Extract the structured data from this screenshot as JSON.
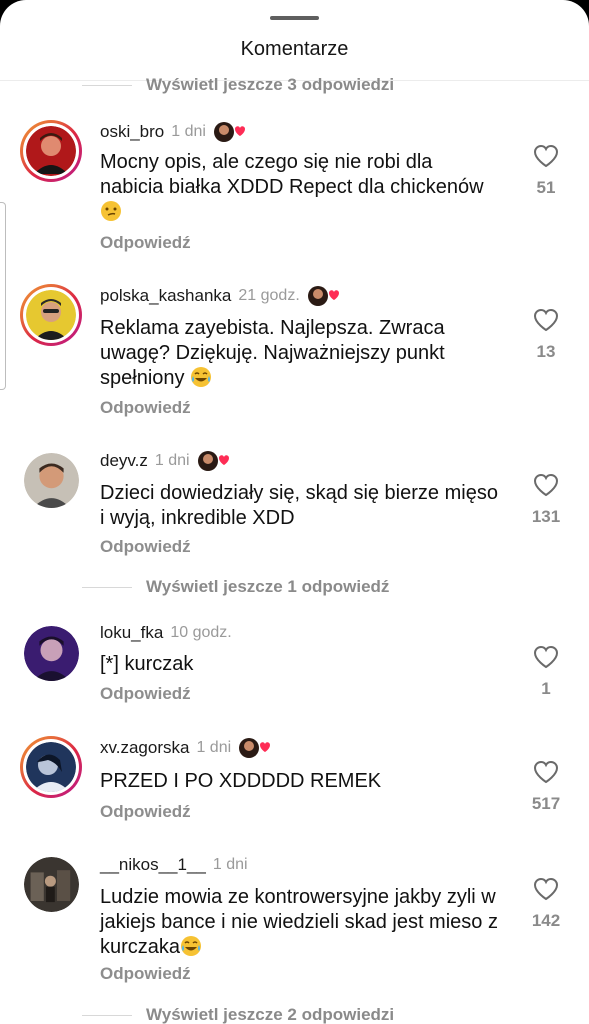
{
  "header": {
    "title": "Komentarze"
  },
  "more_replies": {
    "top": "Wyświetl jeszcze 3 odpowiedzi",
    "middle": "Wyświetl jeszcze 1 odpowiedź",
    "bottom": "Wyświetl jeszcze 2 odpowiedzi"
  },
  "reply_label": "Odpowiedź",
  "comments": [
    {
      "username": "oski_bro",
      "time": "1 dni",
      "text": "Mocny opis, ale czego się nie robi dla nabicia białka XDDD Repect dla chickenów",
      "likes": "51",
      "creator_liked": true,
      "emoji": "smirk-face-icon"
    },
    {
      "username": "polska_kashanka",
      "time": "21 godz.",
      "text": "Reklama zayebista. Najlepsza. Zwraca uwagę? Dziękuję. Najważniejszy punkt spełniony",
      "likes": "13",
      "creator_liked": true,
      "emoji": "tears-of-joy-icon"
    },
    {
      "username": "deyv.z",
      "time": "1 dni",
      "text": "Dzieci dowiedziały się, skąd się bierze mięso i wyją, inkredible XDD",
      "likes": "131",
      "creator_liked": true
    },
    {
      "username": "loku_fka",
      "time": "10 godz.",
      "text": "[*] kurczak",
      "likes": "1",
      "creator_liked": false
    },
    {
      "username": "xv.zagorska",
      "time": "1 dni",
      "text": "PRZED I PO XDDDDD REMEK",
      "likes": "517",
      "creator_liked": true
    },
    {
      "username": "__nikos__1__",
      "time": "1 dni",
      "text": "Ludzie mowia ze kontrowersyjne jakby zyli w jakiejs bance i nie wiedzieli skad jest mieso z kurczaka",
      "likes": "142",
      "creator_liked": false,
      "emoji": "tears-of-joy-icon"
    }
  ],
  "colors": {
    "background": "#ffffff",
    "secondary_text": "#8d8d8d",
    "heart_badge": "#fe2c55"
  }
}
